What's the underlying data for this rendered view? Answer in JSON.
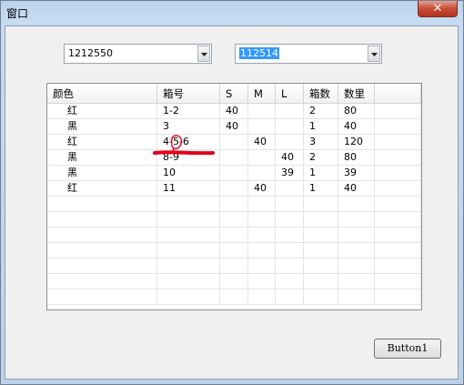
{
  "window": {
    "title": "窗口",
    "close_glyph": "✕"
  },
  "combos": [
    {
      "value": "1212550"
    },
    {
      "value": "112514"
    }
  ],
  "grid": {
    "columns": [
      "颜色",
      "箱号",
      "S",
      "M",
      "L",
      "箱数",
      "数里"
    ],
    "rows": [
      [
        "红",
        "1-2",
        "40",
        "",
        "",
        "2",
        "80"
      ],
      [
        "黑",
        "3",
        "40",
        "",
        "",
        "1",
        "40"
      ],
      [
        "红",
        "4-5-6",
        "",
        "40",
        "",
        "3",
        "120"
      ],
      [
        "黑",
        "8-9",
        "",
        "",
        "40",
        "2",
        "80"
      ],
      [
        "黑",
        "10",
        "",
        "",
        "39",
        "1",
        "39"
      ],
      [
        "红",
        "11",
        "",
        "40",
        "",
        "1",
        "40"
      ]
    ],
    "empty_rows": 7
  },
  "annotation_color": "#e0001a",
  "button": {
    "label": "Button1"
  }
}
